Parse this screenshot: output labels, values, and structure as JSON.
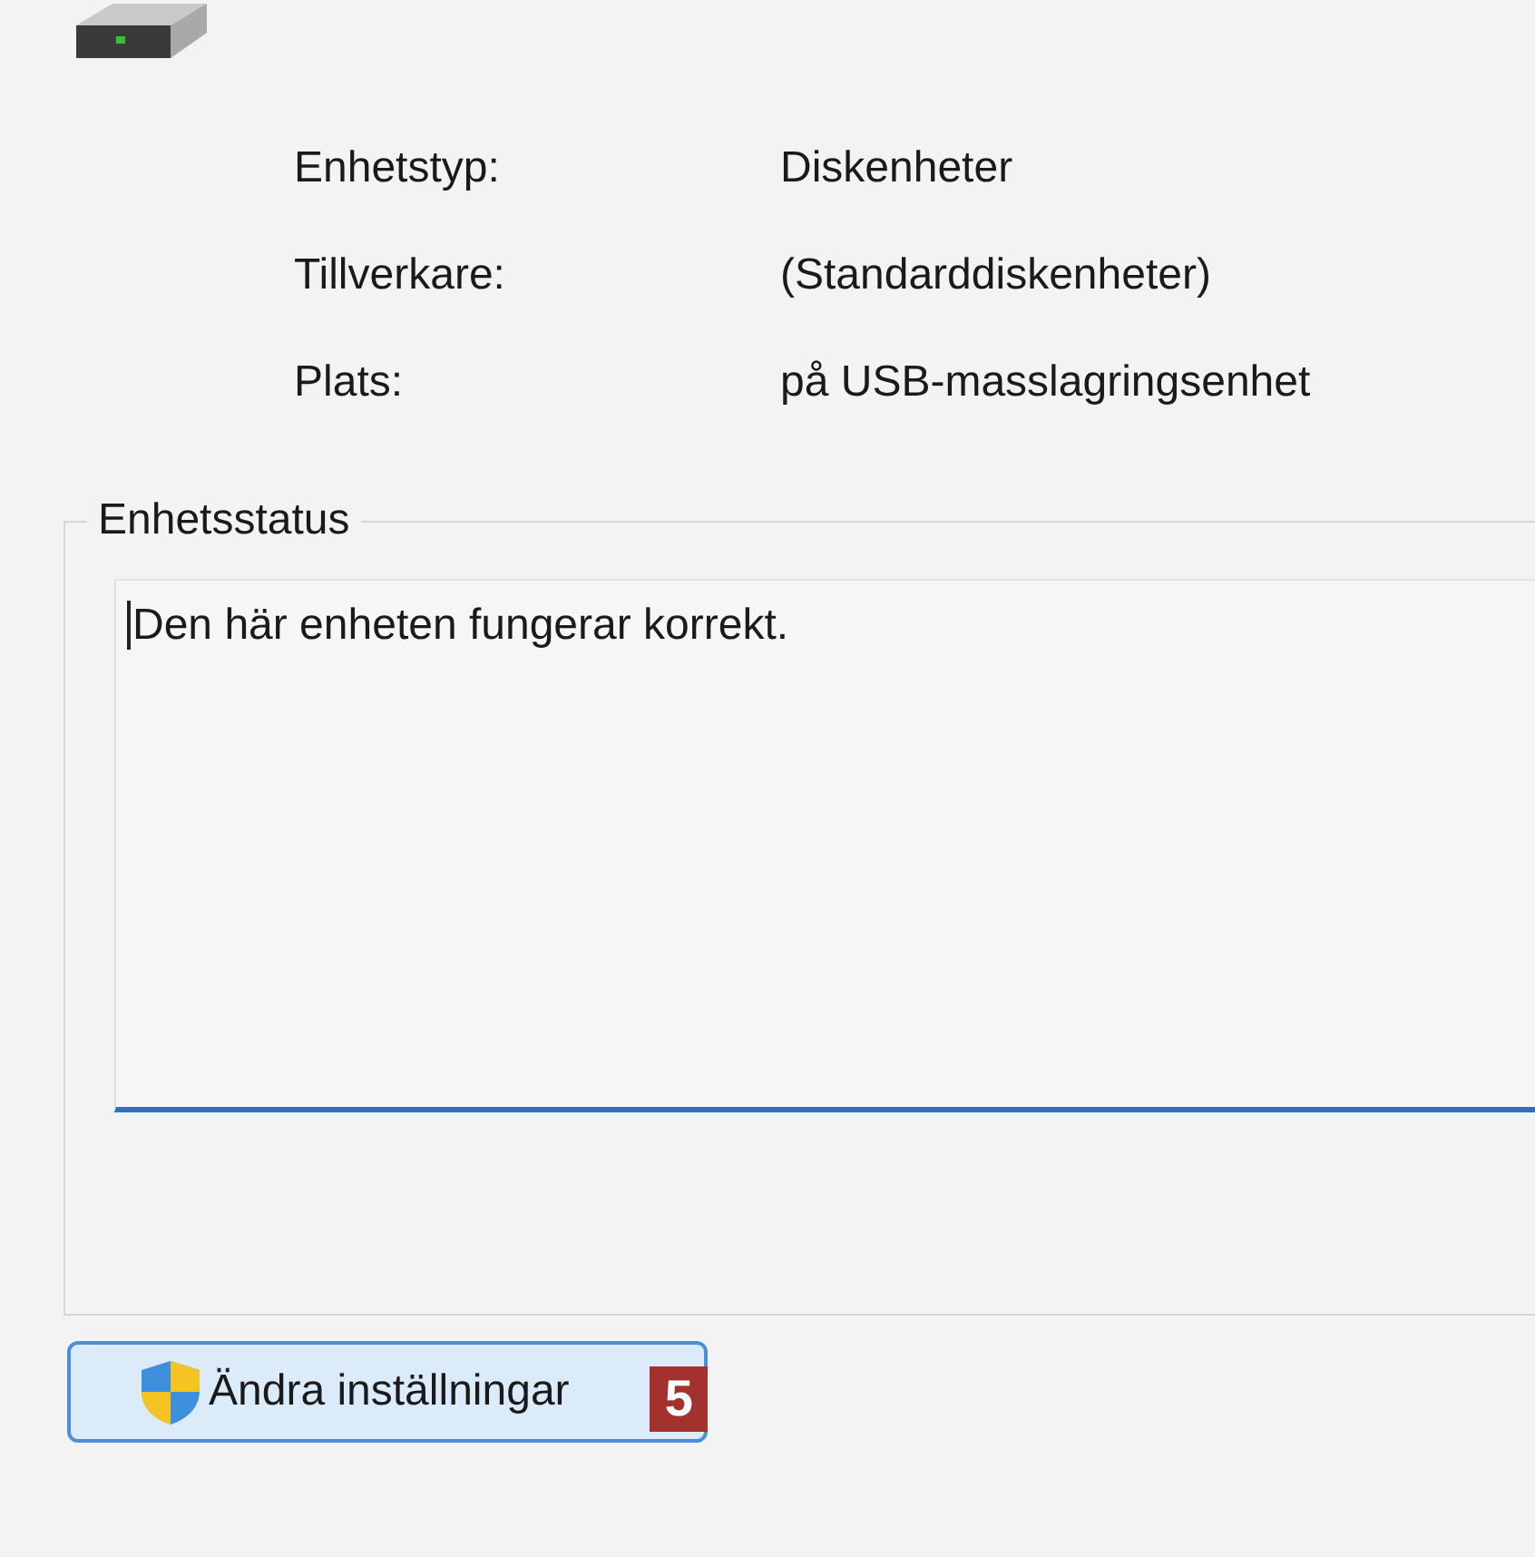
{
  "properties": [
    {
      "label": "Enhetstyp:",
      "value": "Diskenheter"
    },
    {
      "label": "Tillverkare:",
      "value": "(Standarddiskenheter)"
    },
    {
      "label": "Plats:",
      "value": "på USB-masslagringsenhet"
    }
  ],
  "status_group": {
    "title": "Enhetsstatus",
    "text": "Den här enheten fungerar korrekt."
  },
  "button": {
    "label": "Ändra inställningar",
    "badge": "5"
  }
}
